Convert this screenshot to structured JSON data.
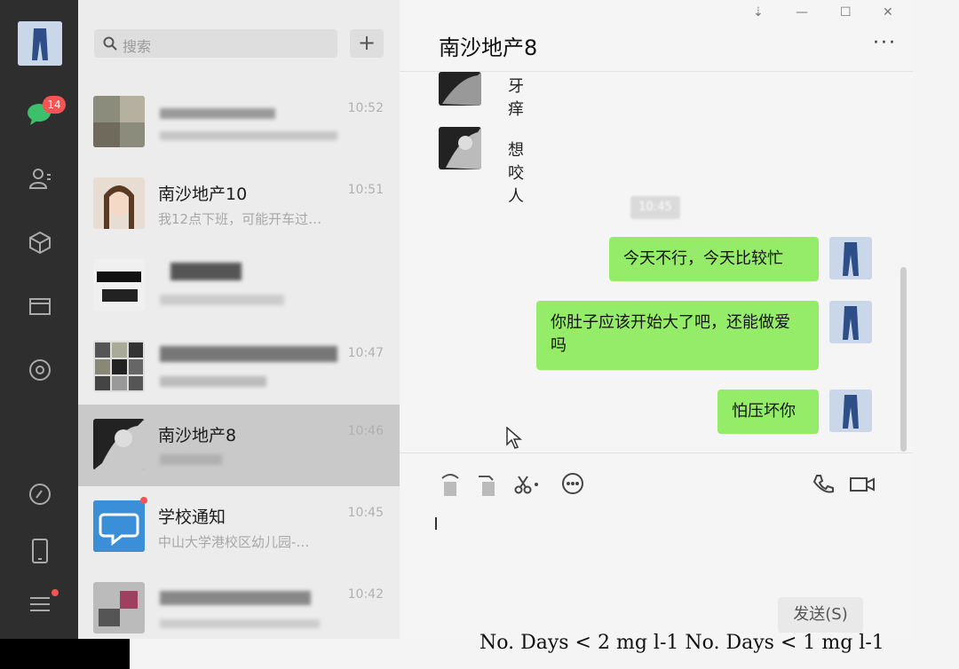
{
  "colors": {
    "rail_bg": "#2e2e2e",
    "bubble_self": "#95ec69",
    "badge": "#f45454",
    "list_selected": "#c9c9c9"
  },
  "rail": {
    "unread_badge": "14",
    "icons": [
      "chat-icon",
      "contacts-icon",
      "box-icon",
      "folder-icon",
      "settings-icon",
      "moments-icon",
      "phone-icon",
      "menu-icon"
    ]
  },
  "search": {
    "placeholder": "搜索",
    "add_label": "+"
  },
  "sessions": [
    {
      "name": "",
      "time": "10:52",
      "preview": ""
    },
    {
      "name": "南沙地产10",
      "time": "10:51",
      "preview": "我12点下班，可能开车过…"
    },
    {
      "name": "",
      "time": "",
      "preview": ""
    },
    {
      "name": "",
      "time": "10:47",
      "preview": ""
    },
    {
      "name": "南沙地产8",
      "time": "10:46",
      "preview": "",
      "selected": true
    },
    {
      "name": "学校通知",
      "time": "10:45",
      "preview": "中山大学港校区幼儿园-…"
    },
    {
      "name": "",
      "time": "10:42",
      "preview": ""
    }
  ],
  "chat": {
    "title": "南沙地产8",
    "more_label": "···",
    "window_controls": [
      "⇣",
      "—",
      "☐",
      "✕"
    ],
    "messages": [
      {
        "from": "other",
        "text": "牙痒"
      },
      {
        "from": "other",
        "text": "想咬人"
      },
      {
        "from": "self",
        "text": "今天不行，今天比较忙"
      },
      {
        "from": "self",
        "text": "你肚子应该开始大了吧，还能做爱吗"
      },
      {
        "from": "self",
        "text": "怕压坏你"
      }
    ],
    "time_chip": "10:45",
    "send_label": "发送(S)"
  },
  "footer_text": "No. Days < 2 mg l-1 No. Days < 1 mg l-1"
}
